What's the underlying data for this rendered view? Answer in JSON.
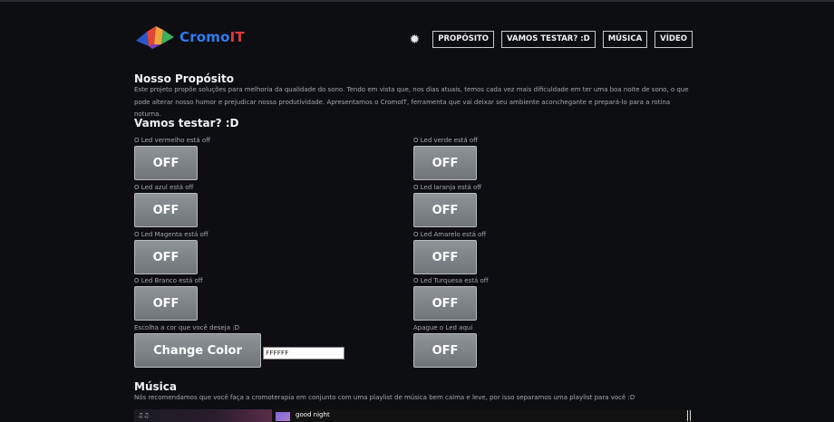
{
  "header": {
    "logo_text_part1": "Cromo",
    "logo_text_part2": "IT",
    "nav": [
      "PROPÓSITO",
      "VAMOS TESTAR? :D",
      "MÚSICA",
      "VÍDEO"
    ]
  },
  "proposito": {
    "title": "Nosso Propósito",
    "text": "Este projeto propõe soluções para melhoria da qualidade do sono. Tendo em vista que, nos dias atuais, temos cada vez mais dificuldade em ter uma boa noite de sono, o que pode alterar nosso humor e prejudicar nossa produtividade. Apresentamos o CromoIT, ferramenta que vai deixar seu ambiente aconchegante e prepará-lo para a rotina noturna."
  },
  "teste": {
    "title": "Vamos testar? :D",
    "leds": [
      {
        "label": "O Led vermelho está off",
        "button": "OFF"
      },
      {
        "label": "O Led verde está off",
        "button": "OFF"
      },
      {
        "label": "O Led azul está off",
        "button": "OFF"
      },
      {
        "label": "O Led laranja está off",
        "button": "OFF"
      },
      {
        "label": "O Led Magenta está off",
        "button": "OFF"
      },
      {
        "label": "O Led Amarelo está off",
        "button": "OFF"
      },
      {
        "label": "O Led Branco está off",
        "button": "OFF"
      },
      {
        "label": "O Led Turquesa está off",
        "button": "OFF"
      }
    ],
    "color_label": "Escolha a cor que você deseja :D",
    "change_button": "Change Color",
    "color_value": "FFFFFF",
    "off_label": "Apague o Led aqui",
    "off_button": "OFF"
  },
  "musica": {
    "title": "Música",
    "text": "Nós recomendamos que você faça a cromoterapia em conjunto com uma playlist de música bem calma e leve, por isso separamos uma playlist para você :D",
    "track": "good night"
  },
  "colors": {
    "background": "#0d0e12",
    "button": "#7f8588",
    "logo_blue": "#2f7cf0",
    "logo_red": "#e23a3a"
  }
}
